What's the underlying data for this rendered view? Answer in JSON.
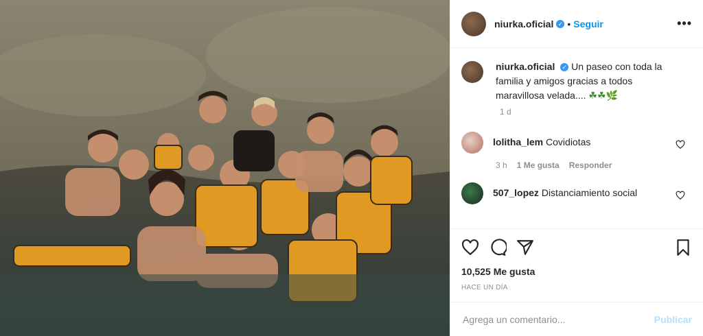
{
  "post": {
    "username": "niurka.oficial",
    "follow_label": "Seguir",
    "separator": "•",
    "more_label": "•••"
  },
  "caption": {
    "username": "niurka.oficial",
    "text": "Un paseo con toda la familia y amigos gracias a todos maravillosa velada....",
    "emojis": "☘☘🌿",
    "time": "1 d"
  },
  "comments": [
    {
      "username": "lolitha_lem",
      "text": "Covidiotas",
      "time": "3 h",
      "likes": "1 Me gusta",
      "reply": "Responder"
    },
    {
      "username": "507_lopez",
      "text": "Distanciamiento social"
    }
  ],
  "likes_text": "10,525 Me gusta",
  "posted_ago": "HACE UN DÍA",
  "add_comment": {
    "placeholder": "Agrega un comentario...",
    "publish_label": "Publicar"
  },
  "colors": {
    "link_blue": "#0095f6",
    "verified": "#3897f0",
    "publish_disabled": "#b2dffc"
  }
}
